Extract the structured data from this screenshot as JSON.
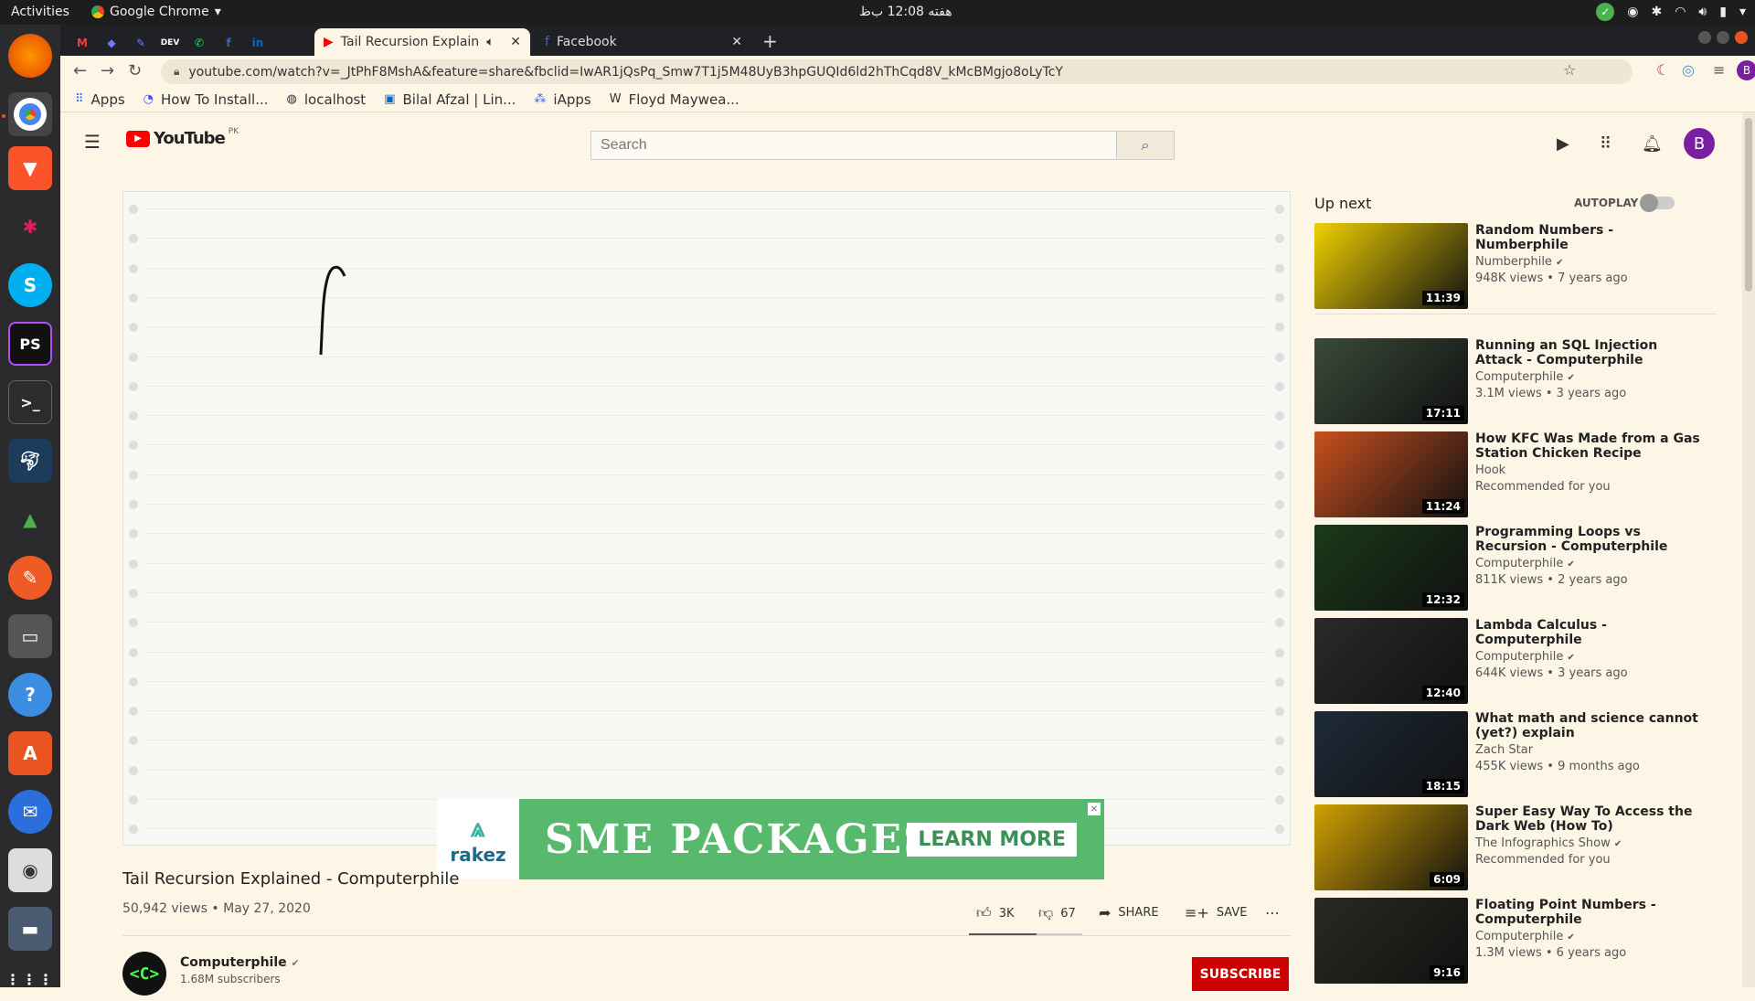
{
  "system": {
    "activities": "Activities",
    "app_menu": "Google Chrome",
    "clock": "هفته 12:08 ب‌ظ"
  },
  "browser": {
    "tabs": [
      {
        "title": "Tail Recursion Explain",
        "active": true
      },
      {
        "title": "Facebook",
        "active": false
      }
    ],
    "pinned": [
      "M",
      "◆",
      "✎",
      "DEV",
      "✆",
      "f",
      "in"
    ],
    "url": "youtube.com/watch?v=_JtPhF8MshA&feature=share&fbclid=IwAR1jQsPq_Smw7T1j5M48UyB3hpGUQId6ld2hThCqd8V_kMcBMgjo8oLyTcY",
    "profile_initial": "B",
    "bookmarks": [
      {
        "label": "Apps",
        "icon": "apps-grid-icon"
      },
      {
        "label": "How To Install...",
        "icon": "github-icon"
      },
      {
        "label": "localhost",
        "icon": "globe-icon"
      },
      {
        "label": "Bilal Afzal | Lin...",
        "icon": "linkedin-icon"
      },
      {
        "label": "iApps",
        "icon": "iapps-icon"
      },
      {
        "label": "Floyd Maywea...",
        "icon": "wikipedia-icon"
      }
    ]
  },
  "youtube": {
    "logo_text": "YouTube",
    "region": "PK",
    "search_placeholder": "Search",
    "avatar_initial": "B",
    "video": {
      "title": "Tail Recursion Explained - Computerphile",
      "views_date": "50,942 views • May 27, 2020",
      "likes": "3K",
      "like_ratio": 0.6,
      "dislikes": "67",
      "share": "SHARE",
      "save": "SAVE",
      "channel": "Computerphile",
      "subscribers": "1.68M subscribers",
      "subscribe": "SUBSCRIBE"
    },
    "ad": {
      "brand": "rakez",
      "headline": "SME PACKAGES",
      "cta": "LEARN MORE"
    },
    "up_next": "Up next",
    "autoplay": "AUTOPLAY",
    "recommendations": [
      {
        "title": "Random Numbers - Numberphile",
        "channel": "Numberphile",
        "verified": true,
        "views": "948K views • 7 years ago",
        "duration": "11:39",
        "color": "#f0d000"
      },
      {
        "title": "Running an SQL Injection Attack - Computerphile",
        "channel": "Computerphile",
        "verified": true,
        "views": "3.1M views • 3 years ago",
        "duration": "17:11",
        "color": "#3a4a3a"
      },
      {
        "title": "How KFC Was Made from a Gas Station Chicken Recipe",
        "channel": "Hook",
        "verified": false,
        "views": "Recommended for you",
        "duration": "11:24",
        "color": "#c8501e"
      },
      {
        "title": "Programming Loops vs Recursion - Computerphile",
        "channel": "Computerphile",
        "verified": true,
        "views": "811K views • 2 years ago",
        "duration": "12:32",
        "color": "#1a3a1a"
      },
      {
        "title": "Lambda Calculus - Computerphile",
        "channel": "Computerphile",
        "verified": true,
        "views": "644K views • 3 years ago",
        "duration": "12:40",
        "color": "#2a2a2a"
      },
      {
        "title": "What math and science cannot (yet?) explain",
        "channel": "Zach Star",
        "verified": false,
        "views": "455K views • 9 months ago",
        "duration": "18:15",
        "color": "#1e2a3a"
      },
      {
        "title": "Super Easy Way To Access the Dark Web (How To)",
        "channel": "The Infographics Show",
        "verified": true,
        "views": "Recommended for you",
        "duration": "6:09",
        "color": "#d0a000"
      },
      {
        "title": "Floating Point Numbers - Computerphile",
        "channel": "Computerphile",
        "verified": true,
        "views": "1.3M views • 6 years ago",
        "duration": "9:16",
        "color": "#2a2a22"
      }
    ]
  }
}
